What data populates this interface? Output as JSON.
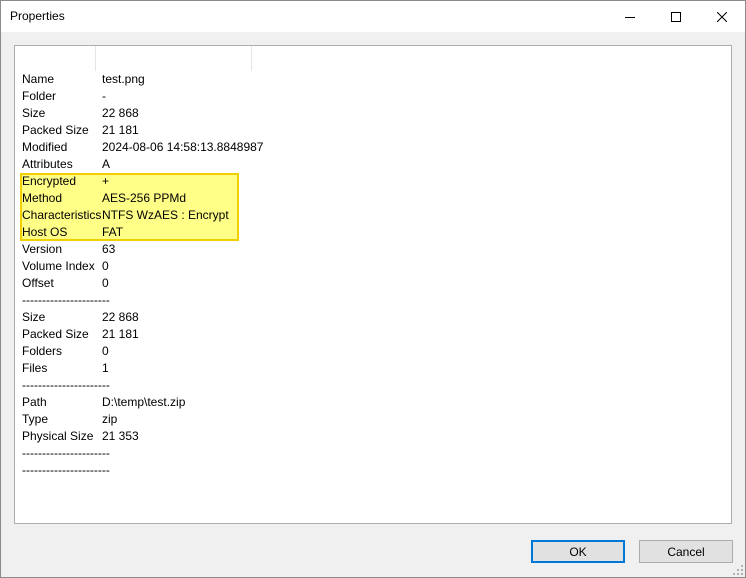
{
  "window": {
    "title": "Properties"
  },
  "properties": [
    {
      "name": "Name",
      "value": "test.png"
    },
    {
      "name": "Folder",
      "value": "-"
    },
    {
      "name": "Size",
      "value": "22 868"
    },
    {
      "name": "Packed Size",
      "value": "21 181"
    },
    {
      "name": "Modified",
      "value": "2024-08-06 14:58:13.8848987"
    },
    {
      "name": "Attributes",
      "value": "A"
    },
    {
      "name": "Encrypted",
      "value": "+"
    },
    {
      "name": "Method",
      "value": "AES-256 PPMd"
    },
    {
      "name": "Characteristics",
      "value": "NTFS WzAES : Encrypt"
    },
    {
      "name": "Host OS",
      "value": "FAT"
    },
    {
      "name": "Version",
      "value": "63"
    },
    {
      "name": "Volume Index",
      "value": "0"
    },
    {
      "name": "Offset",
      "value": "0"
    },
    {
      "name": "----------------------",
      "value": ""
    },
    {
      "name": "Size",
      "value": "22 868"
    },
    {
      "name": "Packed Size",
      "value": "21 181"
    },
    {
      "name": "Folders",
      "value": "0"
    },
    {
      "name": "Files",
      "value": "1"
    },
    {
      "name": "----------------------",
      "value": ""
    },
    {
      "name": "Path",
      "value": "D:\\temp\\test.zip"
    },
    {
      "name": "Type",
      "value": "zip"
    },
    {
      "name": "Physical Size",
      "value": "21 353"
    },
    {
      "name": "----------------------",
      "value": ""
    },
    {
      "name": "----------------------",
      "value": ""
    }
  ],
  "buttons": {
    "ok_label": "OK",
    "cancel_label": "Cancel"
  },
  "colors": {
    "highlight_fill": "#ffff88",
    "highlight_border": "#f0d000",
    "ok_border": "#0078d7"
  }
}
